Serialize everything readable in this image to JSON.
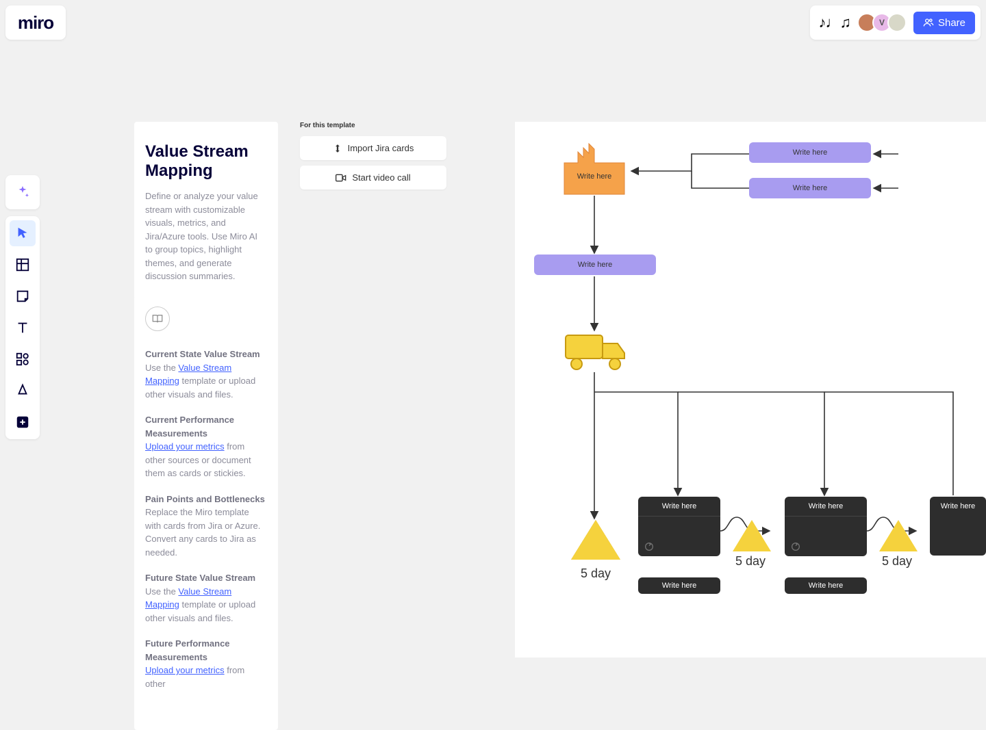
{
  "app": {
    "logo": "miro"
  },
  "topbar": {
    "reactions_glyph": "♪♩♫",
    "share_label": "Share",
    "avatars": [
      {
        "bg": "#c77e5a",
        "text": ""
      },
      {
        "bg": "#e8b9e8",
        "text": "V"
      },
      {
        "bg": "#d8d8c8",
        "text": ""
      }
    ]
  },
  "title_card": {
    "title": "Value Stream Mapping",
    "desc": "Define or analyze your value stream with customizable visuals, metrics, and Jira/Azure tools. Use Miro AI to group topics, highlight themes, and generate discussion summaries."
  },
  "guide": {
    "sections": [
      {
        "heading": "Current State Value Stream",
        "pre": "Use the ",
        "link": "Value Stream Mapping",
        "post": " template or upload other visuals and files."
      },
      {
        "heading": "Current Performance Measurements",
        "pre": "",
        "link": "Upload your metrics",
        "post": " from other sources or document them as cards or stickies."
      },
      {
        "heading": "Pain Points and Bottlenecks",
        "pre": "Replace the Miro template with cards from Jira or Azure. Convert any cards to Jira as needed.",
        "link": "",
        "post": ""
      },
      {
        "heading": "Future State Value Stream",
        "pre": "Use the ",
        "link": "Value Stream Mapping",
        "post": " template or upload other visuals and files."
      },
      {
        "heading": "Future Performance Measurements",
        "pre": "",
        "link": "Upload your metrics",
        "post": " from other"
      }
    ]
  },
  "template_actions": {
    "label": "For this template",
    "import_jira": "Import Jira cards",
    "start_video": "Start video call"
  },
  "diagram": {
    "placeholder": "Write here",
    "durations": [
      "5 day",
      "5 day",
      "5 day"
    ]
  }
}
